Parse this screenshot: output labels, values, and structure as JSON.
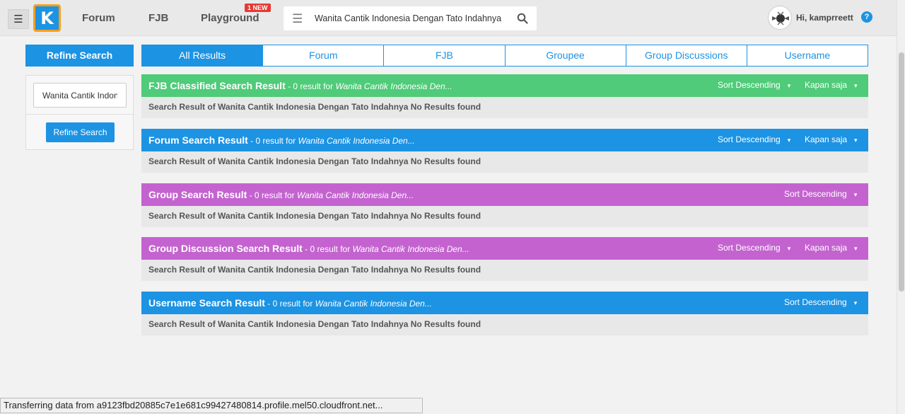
{
  "header": {
    "logo_letter": "K",
    "nav": [
      {
        "label": "Forum"
      },
      {
        "label": "FJB"
      },
      {
        "label": "Playground"
      }
    ],
    "badge": "1 NEW",
    "search_value": "Wanita Cantik Indonesia Dengan Tato Indahnya",
    "greeting": "Hi, kamprreett",
    "help": "?"
  },
  "sidebar": {
    "title": "Refine Search",
    "input_value": "Wanita Cantik Indon",
    "button": "Refine Search"
  },
  "tabs": [
    {
      "label": "All Results",
      "active": true
    },
    {
      "label": "Forum"
    },
    {
      "label": "FJB"
    },
    {
      "label": "Groupee"
    },
    {
      "label": "Group Discussions"
    },
    {
      "label": "Username"
    }
  ],
  "results": [
    {
      "title": "FJB Classified Search Result",
      "meta": " - 0 result for ",
      "query": "Wanita Cantik Indonesia Den...",
      "sort": "Sort Descending",
      "time": "Kapan saja",
      "body": "Search Result of Wanita Cantik Indonesia Dengan Tato Indahnya No Results found",
      "color": "#4fcb79"
    },
    {
      "title": "Forum Search Result",
      "meta": " - 0 result for ",
      "query": "Wanita Cantik Indonesia Den...",
      "sort": "Sort Descending",
      "time": "Kapan saja",
      "body": "Search Result of Wanita Cantik Indonesia Dengan Tato Indahnya No Results found",
      "color": "#1c93e3"
    },
    {
      "title": "Group Search Result",
      "meta": " - 0 result for ",
      "query": "Wanita Cantik Indonesia Den...",
      "sort": "Sort Descending",
      "body": "Search Result of Wanita Cantik Indonesia Dengan Tato Indahnya No Results found",
      "color": "#c463d0"
    },
    {
      "title": "Group Discussion Search Result",
      "meta": " - 0 result for ",
      "query": "Wanita Cantik Indonesia Den...",
      "sort": "Sort Descending",
      "time": "Kapan saja",
      "body": "Search Result of Wanita Cantik Indonesia Dengan Tato Indahnya No Results found",
      "color": "#c463d0"
    },
    {
      "title": "Username Search Result",
      "meta": " - 0 result for ",
      "query": "Wanita Cantik Indonesia Den...",
      "sort": "Sort Descending",
      "body": "Search Result of Wanita Cantik Indonesia Dengan Tato Indahnya No Results found",
      "color": "#1c93e3"
    }
  ],
  "status_text": "Transferring data from a9123fbd20885c7e1e681c99427480814.profile.mel50.cloudfront.net..."
}
